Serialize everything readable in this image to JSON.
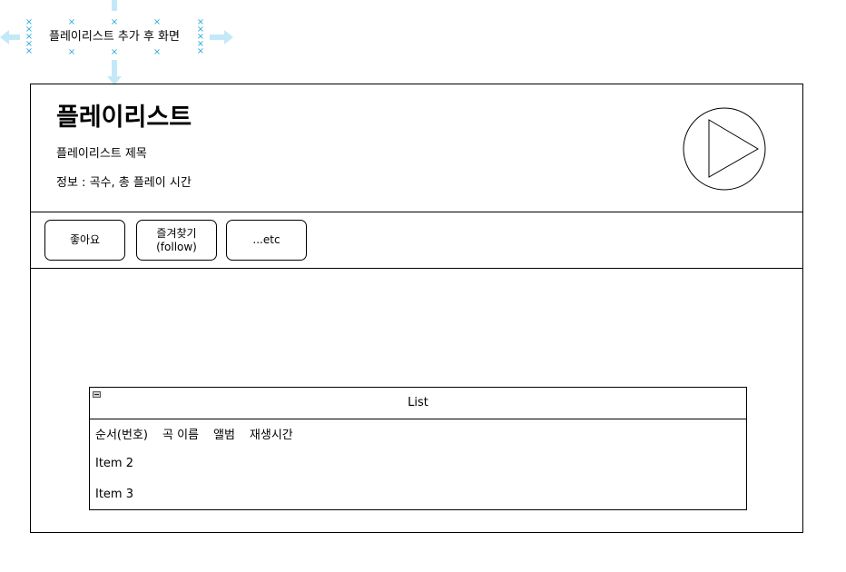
{
  "annotation": {
    "selected_label": "플레이리스트 추가 후 화면"
  },
  "header": {
    "heading": "플레이리스트",
    "title": "플레이리스트 제목",
    "info": "정보 : 곡수, 총 플레이 시간"
  },
  "actions": {
    "like": "좋아요",
    "favorite": "즐겨찾기\n(follow)",
    "etc": "...etc"
  },
  "list": {
    "title": "List",
    "columns": [
      "순서(번호)",
      "곡 이름",
      "앨범",
      "재생시간"
    ],
    "items": [
      "Item 2",
      "Item 3"
    ]
  },
  "colors": {
    "selection_handle": "#29a8e0",
    "selection_arrow": "#c3e9f9",
    "stroke": "#000000"
  },
  "icons": {
    "play": "play-circle-icon",
    "collapse": "collapse-icon"
  }
}
